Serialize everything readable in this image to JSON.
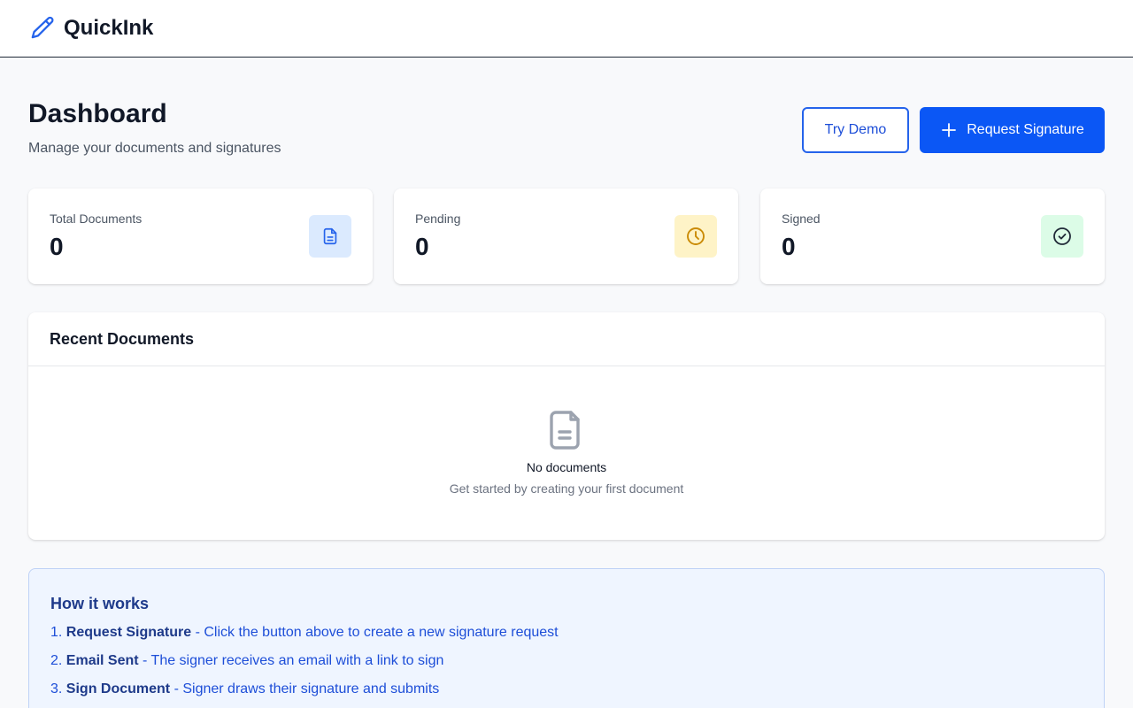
{
  "app": {
    "brand": "QuickInk",
    "logo_icon": "pencil-icon"
  },
  "header": {
    "title": "Dashboard",
    "subtitle": "Manage your documents and signatures",
    "try_demo_label": "Try Demo",
    "request_signature_label": "Request Signature",
    "request_signature_icon": "plus-icon"
  },
  "stats": [
    {
      "label": "Total Documents",
      "value": "0",
      "icon": "document-icon",
      "icon_bg": "#dbeafe",
      "icon_color": "#2563eb"
    },
    {
      "label": "Pending",
      "value": "0",
      "icon": "clock-icon",
      "icon_bg": "#fef3c7",
      "icon_color": "#ca8a04"
    },
    {
      "label": "Signed",
      "value": "0",
      "icon": "check-circle-icon",
      "icon_bg": "#dcfce7",
      "icon_color": "#15803d"
    }
  ],
  "recent": {
    "title": "Recent Documents",
    "empty_icon": "document-icon",
    "empty_title": "No documents",
    "empty_subtitle": "Get started by creating your first document"
  },
  "how_it_works": {
    "title": "How it works",
    "steps": [
      {
        "number": "1.",
        "title": "Request Signature",
        "text": " - Click the button above to create a new signature request"
      },
      {
        "number": "2.",
        "title": "Email Sent",
        "text": " - The signer receives an email with a link to sign"
      },
      {
        "number": "3.",
        "title": "Sign Document",
        "text": " - Signer draws their signature and submits"
      }
    ]
  },
  "colors": {
    "accent": "#0b57f5",
    "page_bg": "#f8f9fb",
    "info_bg": "#eff5ff",
    "info_text": "#1e3a8a"
  }
}
